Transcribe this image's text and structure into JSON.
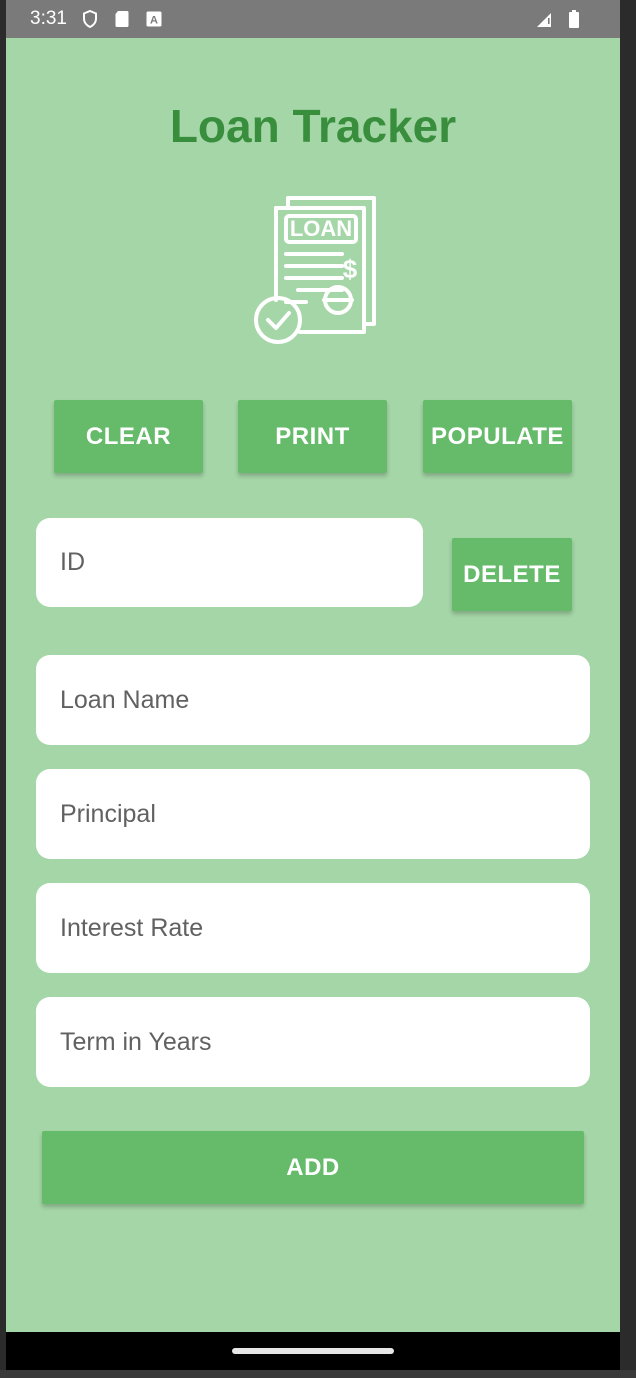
{
  "status_bar": {
    "time": "3:31",
    "icons_left": [
      "shield-icon",
      "sd-card-icon",
      "keyboard-a-icon"
    ],
    "icons_right": [
      "signal-icon",
      "battery-icon"
    ]
  },
  "app": {
    "title": "Loan Tracker",
    "logo_text": "LOAN",
    "logo_currency": "$"
  },
  "actions": {
    "clear_label": "CLEAR",
    "print_label": "PRINT",
    "populate_label": "POPULATE",
    "delete_label": "DELETE",
    "add_label": "ADD"
  },
  "fields": {
    "id_placeholder": "ID",
    "loan_name_placeholder": "Loan Name",
    "principal_placeholder": "Principal",
    "interest_rate_placeholder": "Interest Rate",
    "term_placeholder": "Term in Years"
  },
  "colors": {
    "background": "#a5d6a7",
    "accent": "#66bb6a",
    "title": "#388e3c",
    "field": "#ffffff"
  }
}
